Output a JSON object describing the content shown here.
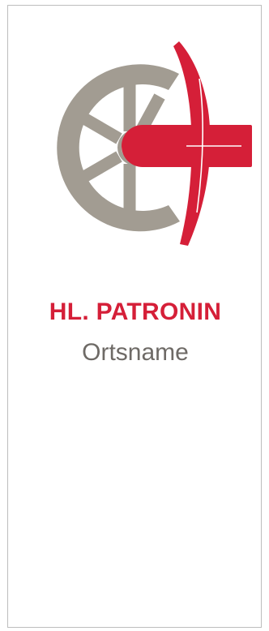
{
  "banner": {
    "title": "HL. PATRONIN",
    "subtitle": "Ortsname"
  },
  "logo": {
    "wheel_icon": "wheel-icon",
    "cross_icon": "cross-icon"
  },
  "colors": {
    "red": "#d51f38",
    "gray": "#a29c92",
    "subtitle_gray": "#6e6a66",
    "border": "#bdbdbd"
  }
}
